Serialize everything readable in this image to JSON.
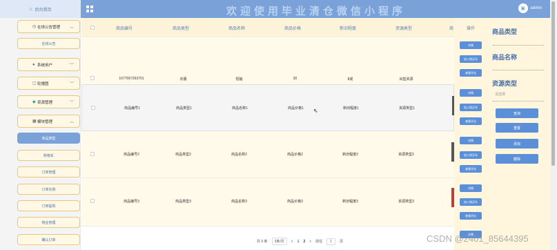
{
  "header": {
    "home_label": "后台首页",
    "title": "欢迎使用毕业清仓微信小程序",
    "username": "admin"
  },
  "sidebar": {
    "groups": [
      {
        "label": "在线公告管理",
        "icon": "clock-icon"
      },
      {
        "label": "系统用户",
        "icon": "user-icon"
      },
      {
        "label": "轮播图",
        "icon": "image-icon"
      },
      {
        "label": "资源管理",
        "icon": "pin-icon"
      },
      {
        "label": "模块管理",
        "icon": "grid-icon"
      }
    ],
    "items": [
      "在线公告",
      "商品类型",
      "购物车",
      "订单管理",
      "订单先购",
      "订单提现",
      "物业管理",
      "确认订单"
    ]
  },
  "table": {
    "headers": [
      "商品编号",
      "商品类型",
      "商品名称",
      "商品价格",
      "新旧程度",
      "资源类型",
      "商"
    ],
    "rows": [
      [
        "1677067263701",
        "衣服",
        "短袖",
        "30",
        "8成",
        "出售资源"
      ],
      [
        "商品编号1",
        "商品类型1",
        "商品名称1",
        "商品价格1",
        "新旧程度1",
        "资源类型1"
      ],
      [
        "商品编号2",
        "商品类型2",
        "商品名称2",
        "商品价格2",
        "新旧程度2",
        "资源类型2"
      ],
      [
        "商品编号3",
        "商品类型3",
        "商品名称3",
        "商品价格3",
        "新旧程度3",
        "资源类型3"
      ]
    ]
  },
  "actions": {
    "header": "操作",
    "detail": "详情",
    "add_cart": "加入购买车",
    "review": "查看评论"
  },
  "pagination": {
    "total": "共 9 条",
    "page_size": "3条/页",
    "prev": "<",
    "pages": [
      "1",
      "2"
    ],
    "next": ">",
    "goto_prefix": "前往",
    "goto_value": "1",
    "goto_suffix": "页"
  },
  "search": {
    "label_type": "商品类型",
    "label_name": "商品名称",
    "label_resource": "资源类型",
    "resource_placeholder": "请选择",
    "btn_query": "查询",
    "btn_reset": "重置",
    "btn_add": "添加",
    "btn_delete": "删除"
  },
  "watermark": "CSDN @2401_85644395",
  "colors": {
    "accent": "#7aa1d8",
    "button": "#5b8fd8",
    "row_bg": "#fffaea"
  }
}
